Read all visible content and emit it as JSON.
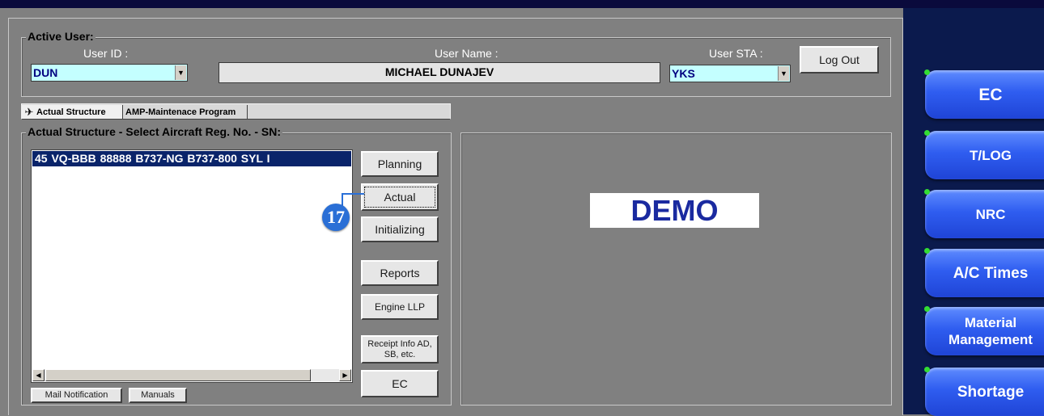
{
  "active_user": {
    "title": "Active User:",
    "user_id_label": "User ID :",
    "user_id_value": "DUN",
    "user_name_label": "User Name :",
    "user_name_value": "MICHAEL DUNAJEV",
    "user_sta_label": "User STA :",
    "user_sta_value": "YKS",
    "logout_label": "Log Out"
  },
  "tabs": [
    {
      "label": "Actual Structure",
      "icon": "aircraft-icon",
      "active": true
    },
    {
      "label": "AMP-Maintenace Program",
      "active": false
    }
  ],
  "structure": {
    "title": "Actual Structure - Select Aircraft Reg. No. - SN:",
    "rows": [
      {
        "text": "45  VQ-BBB  88888  B737-NG  B737-800   SYL   I"
      }
    ]
  },
  "action_buttons": {
    "planning": "Planning",
    "actual": "Actual",
    "initializing": "Initializing",
    "reports": "Reports",
    "engine_llp": "Engine LLP",
    "receipt_line1": "Receipt Info AD,",
    "receipt_line2": "SB, etc.",
    "ec": "EC"
  },
  "bottom_buttons": {
    "mail": "Mail Notification",
    "manuals": "Manuals"
  },
  "demo_label": "DEMO",
  "callout_number": "17",
  "side_menu": [
    {
      "line1": "EC",
      "line2": ""
    },
    {
      "line1": "T/LOG",
      "line2": ""
    },
    {
      "line1": "NRC",
      "line2": ""
    },
    {
      "line1": "A/C Times",
      "line2": ""
    },
    {
      "line1": "Material",
      "line2": "Management"
    },
    {
      "line1": "Shortage",
      "line2": ""
    }
  ],
  "colors": {
    "background": "#808080",
    "combo_fill": "#c4ffff",
    "selection": "#0a246a",
    "side_button": "#2f5df0",
    "demo_text": "#1a2aa0",
    "callout": "#2a6fd6",
    "led": "#33dd33"
  }
}
